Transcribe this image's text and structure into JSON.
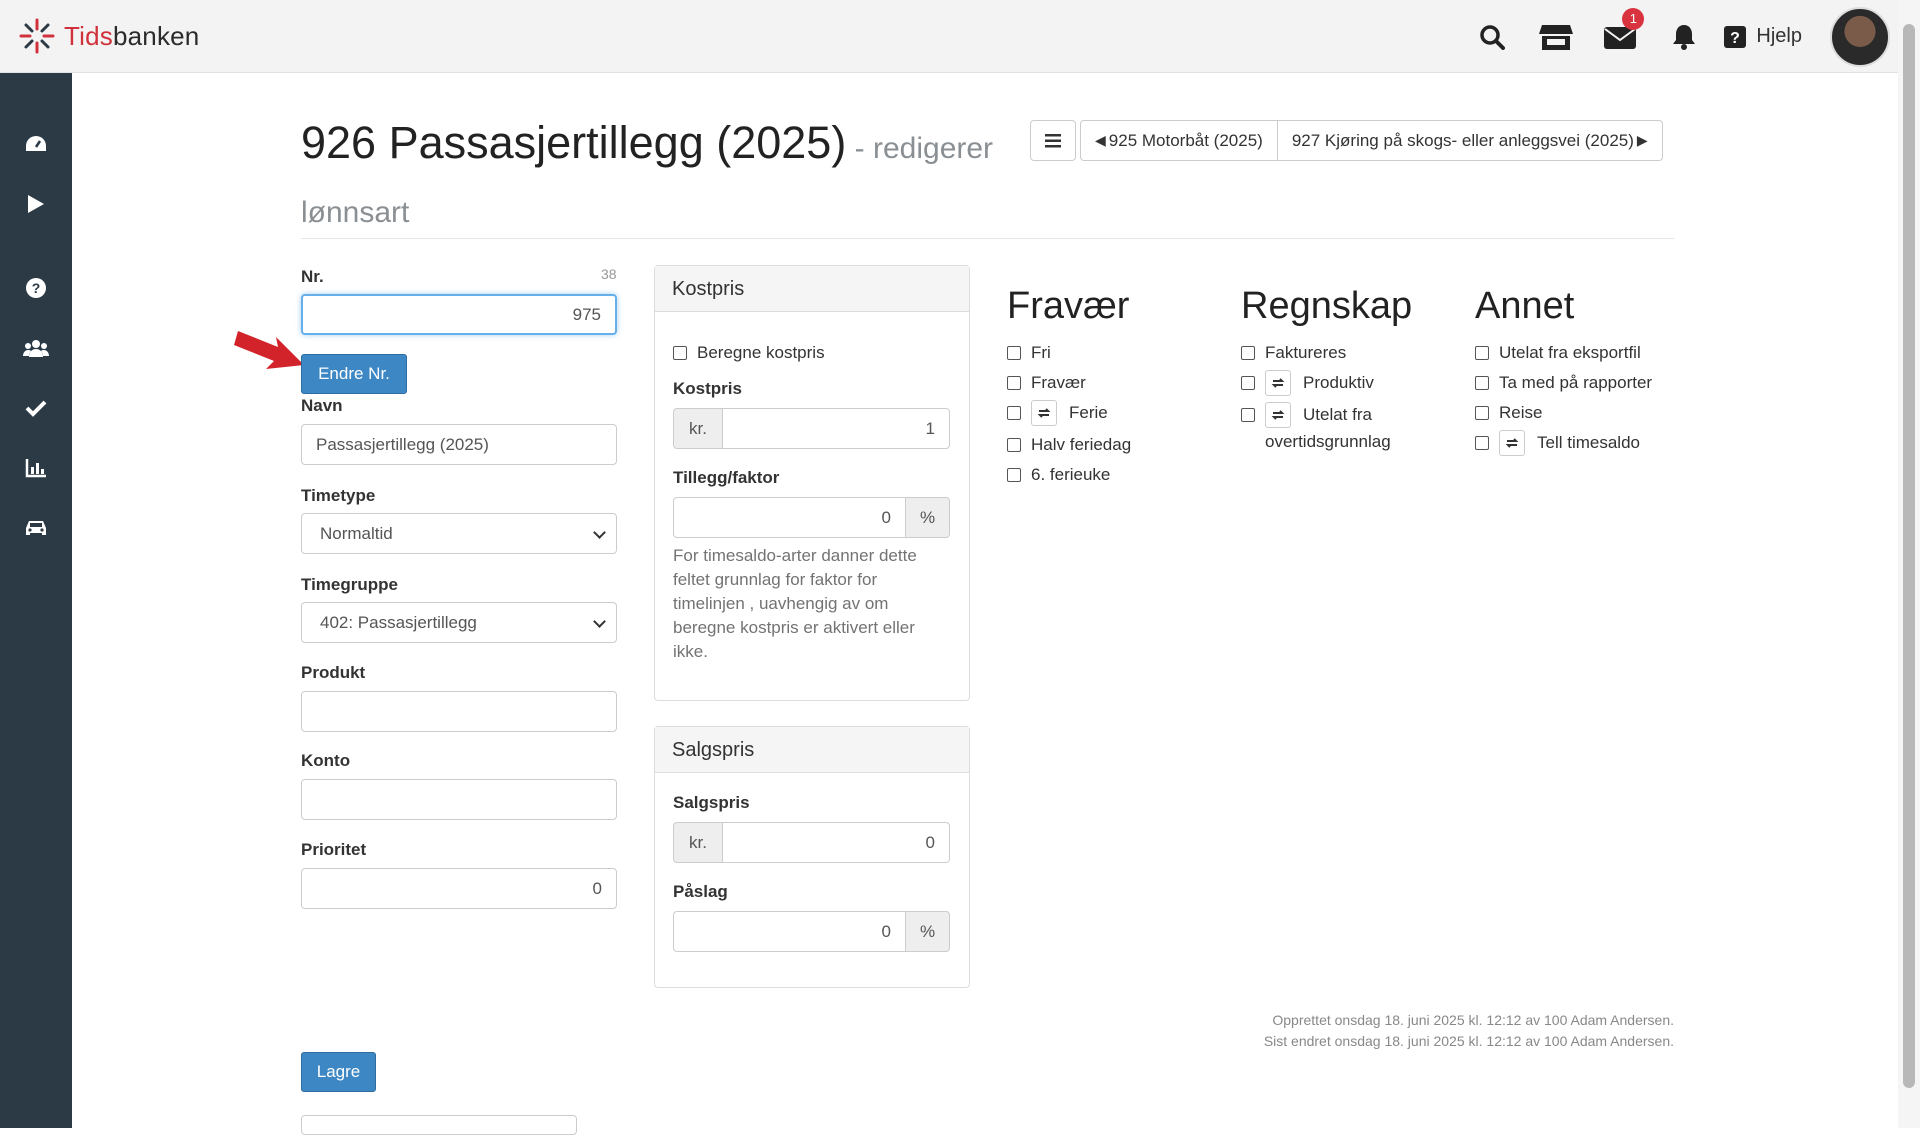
{
  "app": {
    "logo_prefix": "Tids",
    "logo_suffix": "banken",
    "help_label": "Hjelp",
    "mail_badge": "1"
  },
  "page": {
    "title": "926 Passasjertillegg (2025)",
    "subtitle": " - redigerer lønnsart",
    "prev": "925 Motorbåt (2025)",
    "next": "927 Kjøring på skogs- eller anleggsvei (2025)"
  },
  "form": {
    "nr_label": "Nr.",
    "nr_counter": "38",
    "nr_value": "975",
    "change_nr_button": "Endre Nr.",
    "navn_label": "Navn",
    "navn_value": "Passasjertillegg (2025)",
    "timetype_label": "Timetype",
    "timetype_value": "Normaltid",
    "timegruppe_label": "Timegruppe",
    "timegruppe_value": "402: Passasjertillegg",
    "produkt_label": "Produkt",
    "produkt_value": "",
    "konto_label": "Konto",
    "konto_value": "",
    "prioritet_label": "Prioritet",
    "prioritet_value": "0",
    "save_button": "Lagre"
  },
  "kostpris": {
    "heading": "Kostpris",
    "beregne_label": "Beregne kostpris",
    "kostpris_label": "Kostpris",
    "currency": "kr.",
    "kostpris_value": "1",
    "tillegg_label": "Tillegg/faktor",
    "tillegg_value": "0",
    "percent": "%",
    "help": "For timesaldo-arter danner dette feltet grunnlag for faktor for timelinjen , uavhengig av om beregne kostpris er aktivert eller ikke."
  },
  "salgspris": {
    "heading": "Salgspris",
    "salgspris_label": "Salgspris",
    "currency": "kr.",
    "salgspris_value": "0",
    "paslag_label": "Påslag",
    "paslag_value": "0",
    "percent": "%"
  },
  "fravaer": {
    "heading": "Fravær",
    "items": [
      "Fri",
      "Fravær",
      "Ferie",
      "Halv feriedag",
      "6. ferieuke"
    ]
  },
  "regnskap": {
    "heading": "Regnskap",
    "items": [
      "Faktureres",
      "Produktiv",
      "Utelat fra",
      "overtidsgrunnlag"
    ]
  },
  "annet": {
    "heading": "Annet",
    "items": [
      "Utelat fra eksportfil",
      "Ta med på rapporter",
      "Reise",
      "Tell timesaldo"
    ]
  },
  "meta": {
    "created": "Opprettet onsdag 18. juni 2025 kl. 12:12 av 100 Adam Andersen.",
    "modified": "Sist endret onsdag 18. juni 2025 kl. 12:12 av 100 Adam Andersen."
  },
  "icons": [
    "search-icon",
    "store-icon",
    "mail-icon",
    "bell-icon",
    "help-icon",
    "dashboard-icon",
    "play-icon",
    "question-icon",
    "users-icon",
    "check-icon",
    "chart-icon",
    "car-icon",
    "menu-icon",
    "swap-icon"
  ],
  "colors": {
    "sidebar": "#2b3a45",
    "primary": "#3d87c4",
    "badge": "#d9333f",
    "brand_red": "#d0323c",
    "arrow": "#d2232a"
  }
}
